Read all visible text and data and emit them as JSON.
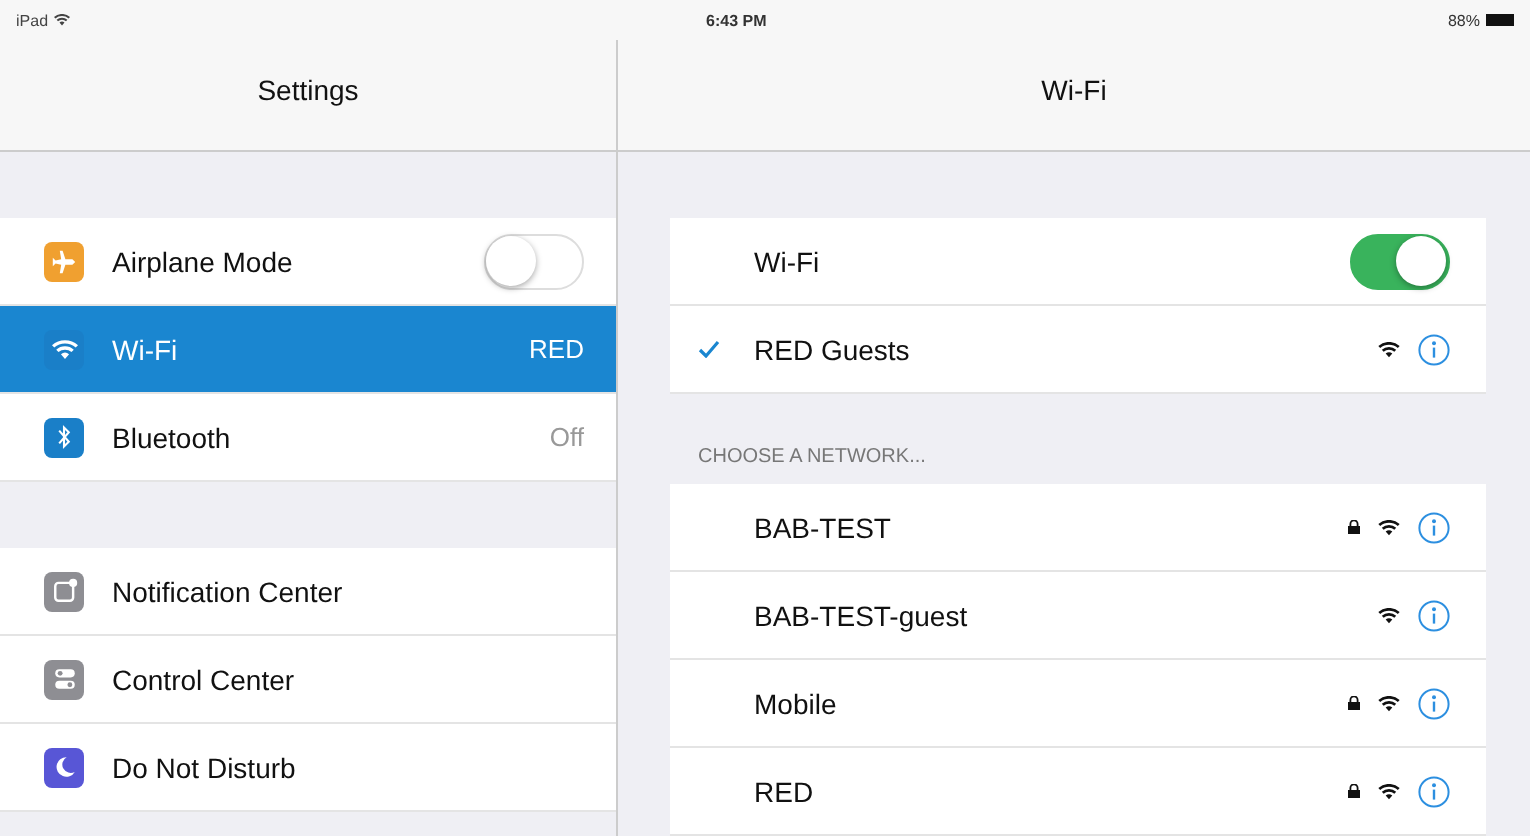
{
  "status_bar": {
    "device": "iPad",
    "time": "6:43 PM",
    "battery": "88%"
  },
  "sidebar": {
    "title": "Settings",
    "groups": [
      [
        {
          "label": "Airplane Mode",
          "kind": "toggle",
          "on": false,
          "selected": false,
          "color": "#f0a030"
        },
        {
          "label": "Wi-Fi",
          "kind": "value",
          "value": "RED",
          "selected": true,
          "color": "#1a7fc8"
        },
        {
          "label": "Bluetooth",
          "kind": "value",
          "value": "Off",
          "selected": false,
          "color": "#1a7fc8"
        }
      ],
      [
        {
          "label": "Notification Center",
          "kind": "link",
          "selected": false,
          "color": "#8e8e93"
        },
        {
          "label": "Control Center",
          "kind": "link",
          "selected": false,
          "color": "#8e8e93"
        },
        {
          "label": "Do Not Disturb",
          "kind": "link",
          "selected": false,
          "color": "#5856d6"
        }
      ]
    ]
  },
  "detail": {
    "title": "Wi-Fi",
    "wifi_toggle": {
      "label": "Wi-Fi",
      "on": true
    },
    "connected": {
      "name": "RED Guests",
      "checked": true
    },
    "section_header": "CHOOSE A NETWORK...",
    "networks": [
      {
        "name": "BAB-TEST",
        "locked": true
      },
      {
        "name": "BAB-TEST-guest",
        "locked": false
      },
      {
        "name": "Mobile",
        "locked": true
      },
      {
        "name": "RED",
        "locked": true
      }
    ]
  }
}
